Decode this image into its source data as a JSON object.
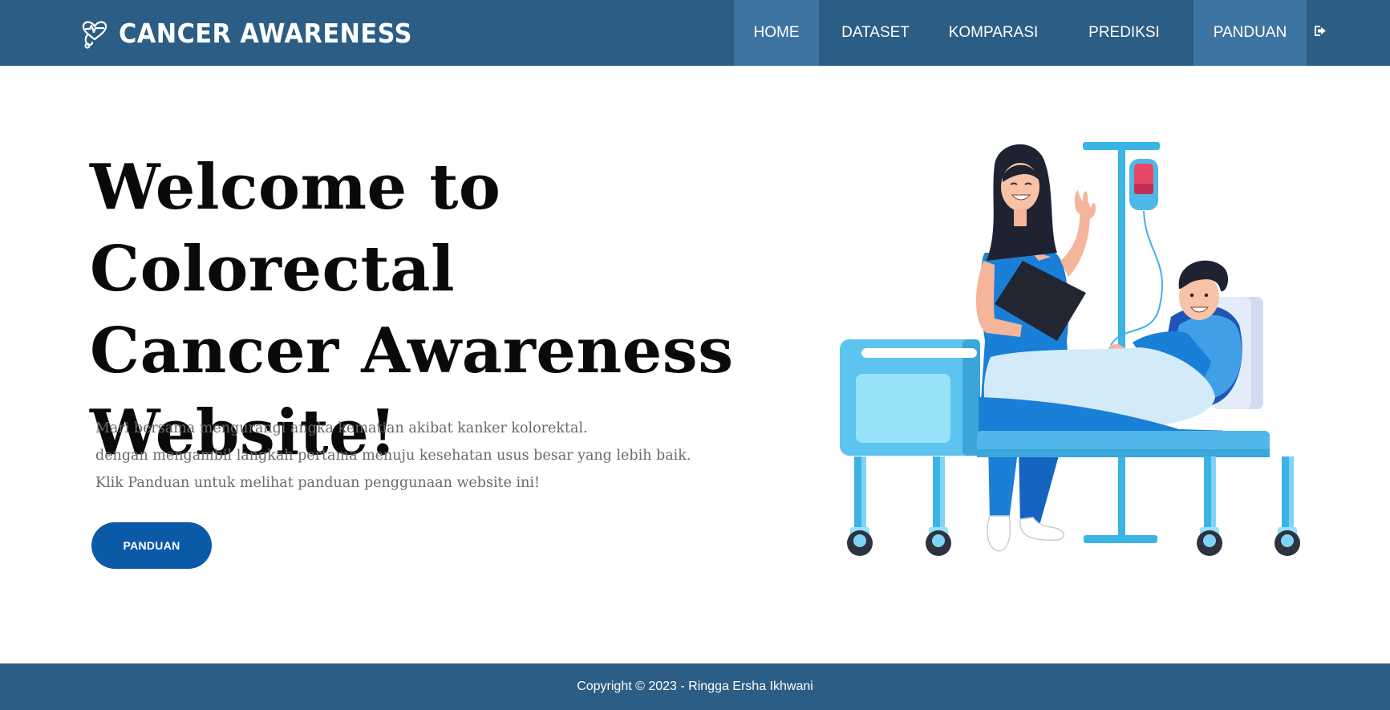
{
  "brand": {
    "title": "CANCER AWARENESS",
    "icon": "heart-stethoscope-icon"
  },
  "nav": {
    "items": [
      {
        "label": "HOME",
        "active": true
      },
      {
        "label": "DATASET",
        "active": false
      },
      {
        "label": "KOMPARASI",
        "active": false
      },
      {
        "label": "PREDIKSI",
        "active": false
      },
      {
        "label": "PANDUAN",
        "active": true
      }
    ],
    "logout_icon": "sign-out-icon"
  },
  "hero": {
    "title_lines": [
      "Welcome to Colorectal",
      "Cancer Awareness",
      "Website!"
    ],
    "description": [
      "Mari bersama mengurangi angka kematian akibat kanker kolorektal.",
      "dengan mengambil langkah pertama menuju kesehatan usus besar yang lebih baik.",
      "Klik Panduan untuk melihat panduan penggunaan website ini!"
    ],
    "button_label": "PANDUAN",
    "illustration": "nurse-patient-hospital-bed-illustration"
  },
  "footer": {
    "copyright": "Copyright © 2023 - Ringga Ersha Ikhwani"
  },
  "colors": {
    "navbar": "#2b5d85",
    "nav_active": "#3e74a2",
    "button": "#0a5aa8",
    "text_dark": "#0a0a0a",
    "text_muted": "#6a6a6a"
  }
}
